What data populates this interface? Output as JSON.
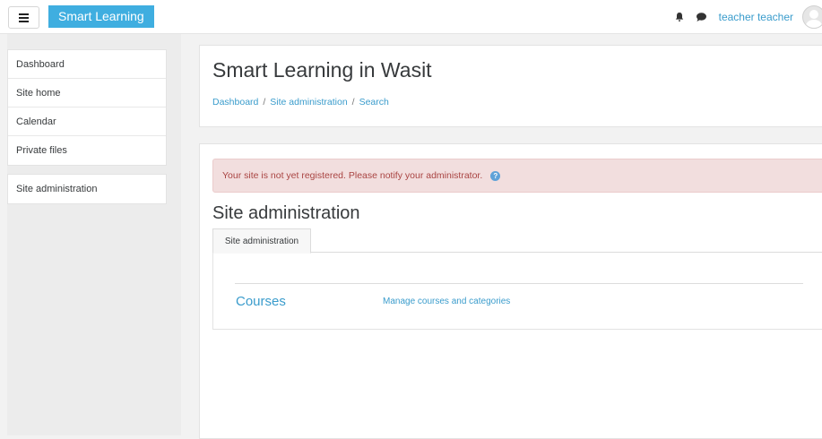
{
  "navbar": {
    "menu_icon": "hamburger-icon",
    "brand": "Smart Learning",
    "notifications_icon": "bell-icon",
    "messages_icon": "chat-bubble-icon",
    "user_name": "teacher teacher",
    "avatar_icon": "user-avatar-icon",
    "accent_color": "#3faee0"
  },
  "sidebar": {
    "items": [
      {
        "label": "Dashboard"
      },
      {
        "label": "Site home"
      },
      {
        "label": "Calendar"
      },
      {
        "label": "Private files"
      }
    ],
    "admin_item": {
      "label": "Site administration"
    }
  },
  "header": {
    "title": "Smart Learning in Wasit",
    "breadcrumb": [
      {
        "label": "Dashboard"
      },
      {
        "label": "Site administration"
      },
      {
        "label": "Search"
      }
    ],
    "breadcrumb_separator": "/"
  },
  "main": {
    "alert": {
      "text": "Your site is not yet registered. Please notify your administrator.",
      "icon": "question-circle-icon",
      "color": "#a94442"
    },
    "section_title": "Site administration",
    "tabs": [
      {
        "label": "Site administration",
        "active": true
      }
    ],
    "results": [
      {
        "heading": "Courses",
        "link": "Manage courses and categories"
      }
    ]
  }
}
